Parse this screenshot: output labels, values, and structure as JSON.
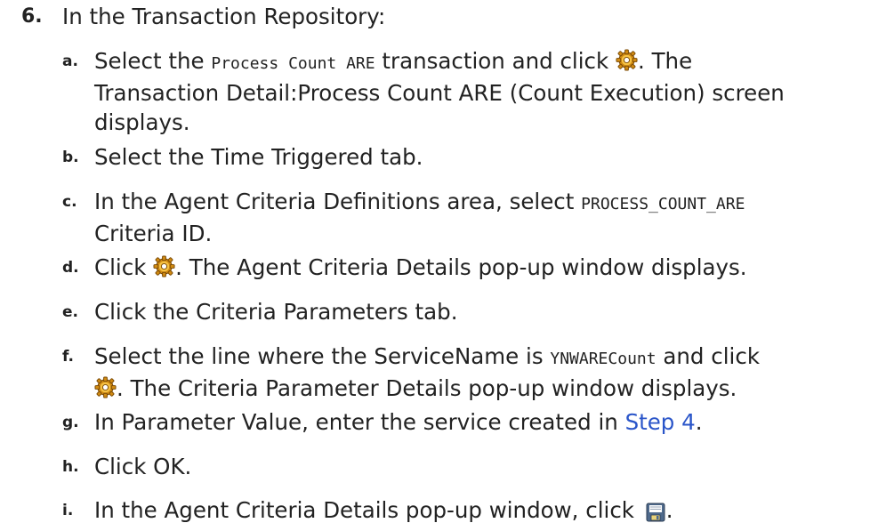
{
  "step": {
    "number": "6.",
    "text": "In the Transaction Repository:"
  },
  "substeps": [
    {
      "letter": "a.",
      "parts": [
        "Select the ",
        "Process Count ARE",
        " transaction and click ",
        ". The",
        "Transaction Detail:Process Count ARE (Count Execution) screen",
        "displays."
      ]
    },
    {
      "letter": "b.",
      "text": "Select the Time Triggered tab."
    },
    {
      "letter": "c.",
      "parts": [
        "In the Agent Criteria Definitions area, select ",
        "PROCESS_COUNT_ARE",
        "Criteria ID."
      ]
    },
    {
      "letter": "d.",
      "parts": [
        "Click ",
        ". The Agent Criteria Details pop-up window displays."
      ]
    },
    {
      "letter": "e.",
      "text": "Click the Criteria Parameters tab."
    },
    {
      "letter": "f.",
      "parts": [
        "Select the line where the ServiceName is ",
        "YNWARECount",
        " and click",
        ". The Criteria Parameter Details pop-up window displays."
      ]
    },
    {
      "letter": "g.",
      "parts": [
        "In Parameter Value, enter the service created in ",
        "Step 4",
        "."
      ]
    },
    {
      "letter": "h.",
      "text": "Click OK."
    },
    {
      "letter": "i.",
      "parts": [
        "In the Agent Criteria Details pop-up window, click ",
        "."
      ]
    }
  ],
  "icons": {
    "details": "gear-details-icon",
    "save": "save-icon"
  },
  "colors": {
    "link": "#2a55c9",
    "text": "#222222"
  }
}
